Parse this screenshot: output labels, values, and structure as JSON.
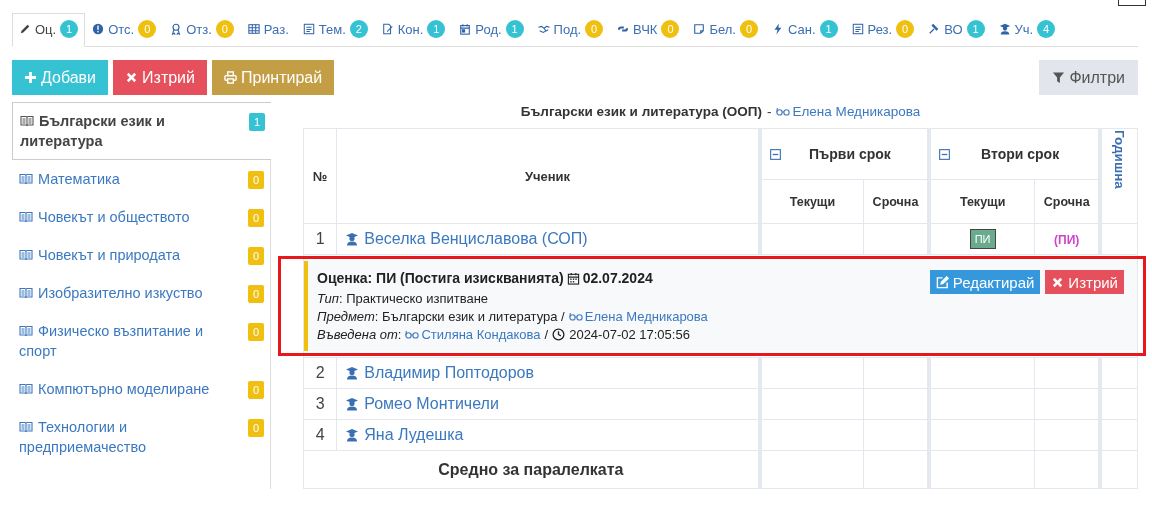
{
  "tabs": [
    {
      "label": "Оц.",
      "count": "1",
      "color": "#35c2d3",
      "selected": true
    },
    {
      "label": "Отс.",
      "count": "0",
      "color": "#f0c010",
      "selected": false
    },
    {
      "label": "Отз.",
      "count": "0",
      "color": "#f0c010",
      "selected": false
    },
    {
      "label": "Раз.",
      "selected": false
    },
    {
      "label": "Тем.",
      "count": "2",
      "color": "#35c2d3",
      "selected": false
    },
    {
      "label": "Кон.",
      "count": "1",
      "color": "#35c2d3",
      "selected": false
    },
    {
      "label": "Род.",
      "count": "1",
      "color": "#35c2d3",
      "selected": false
    },
    {
      "label": "Под.",
      "count": "0",
      "color": "#f0c010",
      "selected": false
    },
    {
      "label": "ВЧК",
      "count": "0",
      "color": "#f0c010",
      "selected": false
    },
    {
      "label": "Бел.",
      "count": "0",
      "color": "#f0c010",
      "selected": false
    },
    {
      "label": "Сан.",
      "count": "1",
      "color": "#35c2d3",
      "selected": false
    },
    {
      "label": "Рез.",
      "count": "0",
      "color": "#f0c010",
      "selected": false
    },
    {
      "label": "ВО",
      "count": "1",
      "color": "#35c2d3",
      "selected": false
    },
    {
      "label": "Уч.",
      "count": "4",
      "color": "#35c2d3",
      "selected": false
    }
  ],
  "actions": [
    {
      "label": "Добави",
      "kind": "add"
    },
    {
      "label": "Изтрий",
      "kind": "delete"
    },
    {
      "label": "Принтирай",
      "kind": "print"
    }
  ],
  "filter_button": {
    "label": "Филтри"
  },
  "subjects": [
    {
      "label": "Български език и литература",
      "count": "1",
      "color": "#35c2d3",
      "selected": true
    },
    {
      "label": "Математика",
      "count": "0",
      "color": "#f0c010",
      "selected": false
    },
    {
      "label": "Човекът и обществото",
      "count": "0",
      "color": "#f0c010",
      "selected": false
    },
    {
      "label": "Човекът и природата",
      "count": "0",
      "color": "#f0c010",
      "selected": false
    },
    {
      "label": "Изобразително изкуство",
      "count": "0",
      "color": "#f0c010",
      "selected": false
    },
    {
      "label": "Физическо възпитание и спорт",
      "count": "0",
      "color": "#f0c010",
      "selected": false
    },
    {
      "label": "Компютърно моделиране",
      "count": "0",
      "color": "#f0c010",
      "selected": false
    },
    {
      "label": "Технологии и предприемачество",
      "count": "0",
      "color": "#f0c010",
      "selected": false
    }
  ],
  "table": {
    "title": "Български език и литература (ООП)",
    "separator": "-",
    "teacher": "Елена Медникарова",
    "number_header": "№",
    "student_header": "Ученик",
    "terms": [
      {
        "label": "Първи срок",
        "columns": [
          "Текущи",
          "Срочна"
        ]
      },
      {
        "label": "Втори срок",
        "columns": [
          "Текущи",
          "Срочна"
        ]
      }
    ],
    "annual_header": "Годишна",
    "rows": [
      {
        "kind": "student",
        "number": "1",
        "name": "Веселка Венциславова (СОП)",
        "grades": {
          "second_term_current": "ПИ",
          "second_term_final": "(ПИ)"
        }
      },
      {
        "kind": "detail",
        "highlighted": true,
        "title": "Оценка: ПИ (Постига изискванията)",
        "date": "02.07.2024",
        "lines": [
          {
            "text": "*Тип*: Практическо изпитване"
          },
          {
            "text": "*Предмет*: Български език и литература /",
            "teacher": "Елена Медникарова"
          },
          {
            "text": "*Въведена от*:",
            "teacher": "Стиляна Кондакова",
            "separator": "/",
            "timestamp": "2024-07-02 17:05:56"
          }
        ],
        "buttons": [
          {
            "label": "Редактирай",
            "kind": "edit"
          },
          {
            "label": "Изтрий",
            "kind": "delete"
          }
        ]
      },
      {
        "kind": "student",
        "number": "2",
        "name": "Владимир Поптодоров"
      },
      {
        "kind": "student",
        "number": "3",
        "name": "Ромео Монтичели"
      },
      {
        "kind": "student",
        "number": "4",
        "name": "Яна Лудешка"
      }
    ],
    "footer": "Средно за паралелката"
  }
}
